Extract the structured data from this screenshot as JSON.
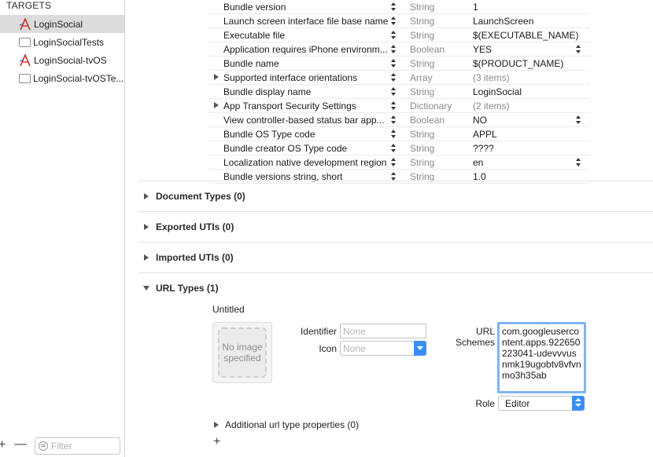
{
  "sidebar": {
    "header": "TARGETS",
    "targets": [
      {
        "label": "LoginSocial",
        "icon": "app-icon",
        "selected": true
      },
      {
        "label": "LoginSocialTests",
        "icon": "test-bundle-icon",
        "selected": false
      },
      {
        "label": "LoginSocial-tvOS",
        "icon": "app-icon",
        "selected": false
      },
      {
        "label": "LoginSocial-tvOSTe...",
        "icon": "test-bundle-icon",
        "selected": false
      }
    ],
    "filter_placeholder": "Filter",
    "add_symbol": "+",
    "remove_symbol": "—"
  },
  "plist": {
    "rows": [
      {
        "key": "Bundle version",
        "type": "String",
        "value": "1"
      },
      {
        "key": "Launch screen interface file base name",
        "type": "String",
        "value": "LaunchScreen"
      },
      {
        "key": "Executable file",
        "type": "String",
        "value": "$(EXECUTABLE_NAME)"
      },
      {
        "key": "Application requires iPhone environm...",
        "type": "Boolean",
        "value": "YES"
      },
      {
        "key": "Bundle name",
        "type": "String",
        "value": "$(PRODUCT_NAME)"
      },
      {
        "key": "Supported interface orientations",
        "type": "Array",
        "value": "(3 items)"
      },
      {
        "key": "Bundle display name",
        "type": "String",
        "value": "LoginSocial"
      },
      {
        "key": "App Transport Security Settings",
        "type": "Dictionary",
        "value": "(2 items)"
      },
      {
        "key": "View controller-based status bar app...",
        "type": "Boolean",
        "value": "NO"
      },
      {
        "key": "Bundle OS Type code",
        "type": "String",
        "value": "APPL"
      },
      {
        "key": "Bundle creator OS Type code",
        "type": "String",
        "value": "????"
      },
      {
        "key": "Localization native development region",
        "type": "String",
        "value": "en"
      },
      {
        "key": "Bundle versions string, short",
        "type": "String",
        "value": "1.0"
      }
    ]
  },
  "sections": {
    "document_types": "Document Types (0)",
    "exported_utis": "Exported UTIs (0)",
    "imported_utis": "Imported UTIs (0)",
    "url_types": "URL Types (1)"
  },
  "url_type": {
    "name": "Untitled",
    "image_placeholder": "No image specified",
    "identifier_label": "Identifier",
    "identifier_placeholder": "None",
    "icon_label": "Icon",
    "icon_placeholder": "None",
    "url_schemes_label": "URL Schemes",
    "url_schemes_value": "com.googleusercontent.apps.922650223041-udevvvusnmk19ugobtv8vfvnmo3h35ab",
    "role_label": "Role",
    "role_value": "Editor",
    "additional_properties": "Additional url type properties (0)",
    "add_symbol": "+"
  },
  "colors": {
    "accent": "#3a8ff7",
    "focus_ring": "#7fb3f5",
    "selection": "#dcdcdc"
  }
}
